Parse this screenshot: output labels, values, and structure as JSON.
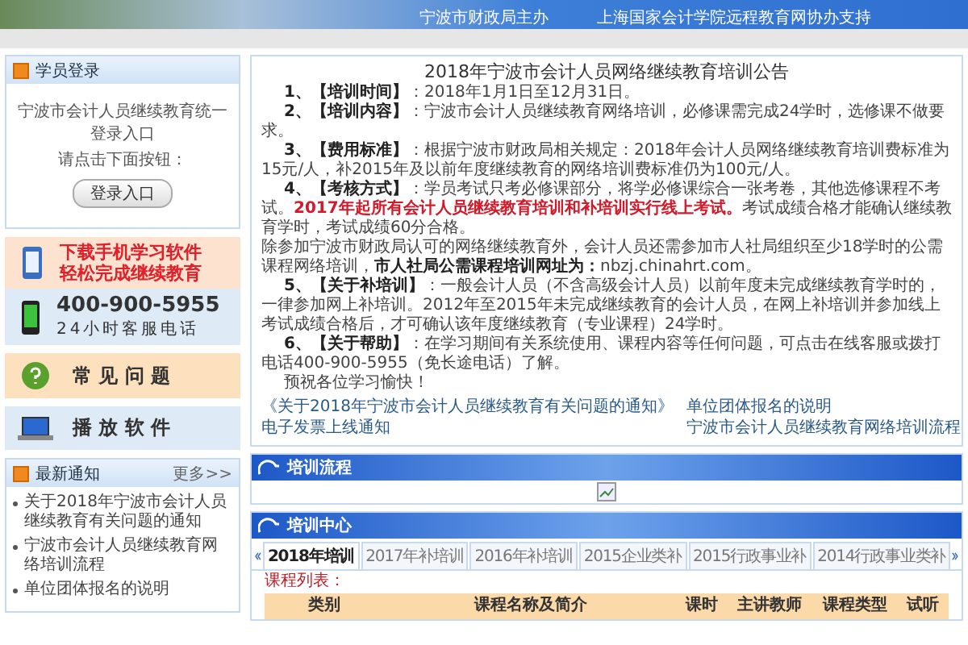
{
  "header": {
    "texts": [
      "宁波市财政局主办",
      "上海国家会计学院远程教育网协办支持"
    ]
  },
  "login": {
    "title": "学员登录",
    "lines": [
      "宁波市会计人员继续教育统一登录入口",
      "请点击下面按钮："
    ],
    "button": "登录入口"
  },
  "promo": {
    "lines": [
      "下载手机学习软件",
      "轻松完成继续教育"
    ]
  },
  "hotline": {
    "number": "400-900-5955",
    "caption": "24小时客服电话"
  },
  "faq": {
    "label": "常 见 问 题"
  },
  "player": {
    "label": "播 放 软 件"
  },
  "news": {
    "title": "最新通知",
    "more": "更多>>",
    "items": [
      "关于2018年宁波市会计人员继续教育有关问题的通知",
      "宁波市会计人员继续教育网络培训流程",
      "单位团体报名的说明"
    ]
  },
  "notice": {
    "title": "2018年宁波市会计人员网络继续教育培训公告",
    "paragraphs": [
      {
        "indent": true,
        "segments": [
          {
            "kind": "label",
            "text": "1、【培训时间】"
          },
          {
            "kind": "plain",
            "text": "：2018年1月1日至12月31日。"
          }
        ]
      },
      {
        "indent": true,
        "segments": [
          {
            "kind": "label",
            "text": "2、【培训内容】"
          },
          {
            "kind": "plain",
            "text": "：宁波市会计人员继续教育网络培训，必修课需完成24学时，选修课不做要求。"
          }
        ]
      },
      {
        "indent": true,
        "segments": [
          {
            "kind": "label",
            "text": "3、【费用标准】"
          },
          {
            "kind": "plain",
            "text": "：根据宁波市财政局相关规定：2018年会计人员网络继续教育培训费标准为15元/人，补2015年及以前年度继续教育的网络培训费标准仍为100元/人。"
          }
        ]
      },
      {
        "indent": true,
        "segments": [
          {
            "kind": "label",
            "text": "4、【考核方式】"
          },
          {
            "kind": "plain",
            "text": "：学员考试只考必修课部分，将学必修课综合一张考卷，其他选修课程不考试。"
          },
          {
            "kind": "alert",
            "text": "2017年起所有会计人员继续教育培训和补培训实行线上考试。"
          },
          {
            "kind": "plain",
            "text": "考试成绩合格才能确认继续教育学时，考试成绩60分合格。"
          }
        ]
      },
      {
        "indent": false,
        "segments": [
          {
            "kind": "plain",
            "text": "除参加宁波市财政局认可的网络继续教育外，会计人员还需参加市人社局组织至少18学时的公需课程网络培训，"
          },
          {
            "kind": "strong",
            "text": "市人社局公需课程培训网址为："
          },
          {
            "kind": "plain",
            "text": "nbzj.chinahrt.com。"
          }
        ]
      },
      {
        "indent": true,
        "segments": [
          {
            "kind": "label",
            "text": "5、【关于补培训】"
          },
          {
            "kind": "plain",
            "text": "：一般会计人员（不含高级会计人员）以前年度未完成继续教育学时的，一律参加网上补培训。2012年至2015年未完成继续教育的会计人员，在网上补培训并参加线上考试成绩合格后，才可确认该年度继续教育（专业课程）24学时。"
          }
        ]
      },
      {
        "indent": true,
        "segments": [
          {
            "kind": "label",
            "text": "6、【关于帮助】"
          },
          {
            "kind": "plain",
            "text": "：在学习期间有关系统使用、课程内容等任何问题，可点击在线客服或拨打电话400-900-5955（免长途电话）了解。"
          }
        ]
      },
      {
        "indent": true,
        "segments": [
          {
            "kind": "plain",
            "text": "预祝各位学习愉快！"
          }
        ]
      }
    ],
    "links": [
      "《关于2018年宁波市会计人员继续教育有关问题的通知》",
      "单位团体报名的说明",
      "电子发票上线通知",
      "宁波市会计人员继续教育网络培训流程"
    ]
  },
  "flow": {
    "title": "培训流程"
  },
  "center": {
    "title": "培训中心",
    "tabs": [
      {
        "label": "2018年培训",
        "selected": true
      },
      {
        "label": "2017年补培训",
        "selected": false
      },
      {
        "label": "2016年补培训",
        "selected": false
      },
      {
        "label": "2015企业类补",
        "selected": false
      },
      {
        "label": "2015行政事业补",
        "selected": false
      },
      {
        "label": "2014行政事业类补",
        "selected": false
      }
    ],
    "list_label": "课程列表：",
    "columns": [
      "类别",
      "课程名称及简介",
      "课时",
      "主讲教师",
      "课程类型",
      "试听"
    ]
  }
}
